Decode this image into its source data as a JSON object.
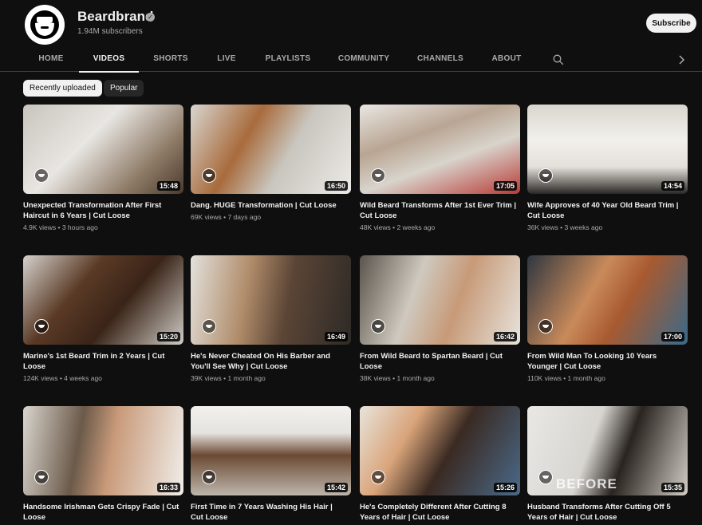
{
  "channel": {
    "name": "Beardbrand",
    "subscribers": "1.94M subscribers",
    "subscribe_label": "Subscribe"
  },
  "tabs": [
    {
      "label": "HOME"
    },
    {
      "label": "VIDEOS",
      "active": true
    },
    {
      "label": "SHORTS"
    },
    {
      "label": "LIVE"
    },
    {
      "label": "PLAYLISTS"
    },
    {
      "label": "COMMUNITY"
    },
    {
      "label": "CHANNELS"
    },
    {
      "label": "ABOUT"
    }
  ],
  "filters": {
    "recently_uploaded": "Recently uploaded",
    "popular": "Popular"
  },
  "videos": [
    {
      "title": "Unexpected Transformation After First Haircut in 6 Years | Cut Loose",
      "views": "4.9K views",
      "age": "3 hours ago",
      "duration": "15:48"
    },
    {
      "title": "Dang. HUGE Transformation | Cut Loose",
      "views": "69K views",
      "age": "7 days ago",
      "duration": "16:50"
    },
    {
      "title": "Wild Beard Transforms After 1st Ever Trim | Cut Loose",
      "views": "48K views",
      "age": "2 weeks ago",
      "duration": "17:05"
    },
    {
      "title": "Wife Approves of 40 Year Old Beard Trim | Cut Loose",
      "views": "36K views",
      "age": "3 weeks ago",
      "duration": "14:54"
    },
    {
      "title": "Marine's 1st Beard Trim in 2 Years | Cut Loose",
      "views": "124K views",
      "age": "4 weeks ago",
      "duration": "15:20"
    },
    {
      "title": "He's Never Cheated On His Barber and You'll See Why | Cut Loose",
      "views": "39K views",
      "age": "1 month ago",
      "duration": "16:49"
    },
    {
      "title": "From Wild Beard to Spartan Beard | Cut Loose",
      "views": "38K views",
      "age": "1 month ago",
      "duration": "16:42"
    },
    {
      "title": "From Wild Man To Looking 10 Years Younger | Cut Loose",
      "views": "110K views",
      "age": "1 month ago",
      "duration": "17:00"
    },
    {
      "title": "Handsome Irishman Gets Crispy Fade | Cut Loose",
      "views": "",
      "age": "",
      "duration": "16:33"
    },
    {
      "title": "First Time in 7 Years Washing His Hair | Cut Loose",
      "views": "",
      "age": "",
      "duration": "15:42"
    },
    {
      "title": "He's Completely Different After Cutting 8 Years of Hair | Cut Loose",
      "views": "",
      "age": "",
      "duration": "15:26"
    },
    {
      "title": "Husband Transforms After Cutting Off 5 Years of Hair | Cut Loose",
      "views": "",
      "age": "",
      "duration": "15:35",
      "thumbnail_text": "BEFORE"
    }
  ],
  "icons": {
    "search": "search-icon",
    "next": "chevron-right-icon",
    "verified": "verified-check-icon",
    "watermark": "beardbrand-watermark-icon"
  },
  "colors": {
    "background": "#0f0f0f",
    "text": "#f1f1f1",
    "secondary_text": "#aaaaaa",
    "chip_background": "#272727"
  }
}
